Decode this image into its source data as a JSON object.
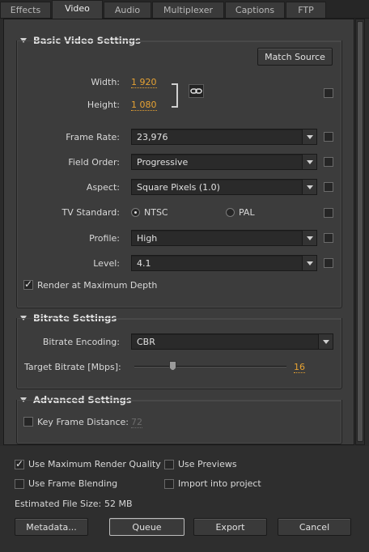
{
  "tabs": [
    "Effects",
    "Video",
    "Audio",
    "Multiplexer",
    "Captions",
    "FTP"
  ],
  "basic": {
    "title": "Basic Video Settings",
    "match_source": "Match Source",
    "width_label": "Width:",
    "width_value": "1 920",
    "height_label": "Height:",
    "height_value": "1 080",
    "frame_rate_label": "Frame Rate:",
    "frame_rate_value": "23,976",
    "field_order_label": "Field Order:",
    "field_order_value": "Progressive",
    "aspect_label": "Aspect:",
    "aspect_value": "Square Pixels (1.0)",
    "tv_standard_label": "TV Standard:",
    "ntsc": "NTSC",
    "pal": "PAL",
    "profile_label": "Profile:",
    "profile_value": "High",
    "level_label": "Level:",
    "level_value": "4.1",
    "render_max_depth": "Render at Maximum Depth"
  },
  "bitrate": {
    "title": "Bitrate Settings",
    "encoding_label": "Bitrate Encoding:",
    "encoding_value": "CBR",
    "target_label": "Target Bitrate [Mbps]:",
    "target_value": "16",
    "slider_fraction": 0.25
  },
  "advanced": {
    "title": "Advanced Settings",
    "key_frame_label": "Key Frame Distance:",
    "key_frame_value": "72"
  },
  "options": {
    "max_render_quality": "Use Maximum Render Quality",
    "use_previews": "Use Previews",
    "frame_blending": "Use Frame Blending",
    "import_project": "Import into project"
  },
  "file_size_label": "Estimated File Size:",
  "file_size_value": "52 MB",
  "buttons": {
    "metadata": "Metadata...",
    "queue": "Queue",
    "export": "Export",
    "cancel": "Cancel"
  },
  "colors": {
    "accent": "#e6a233"
  }
}
